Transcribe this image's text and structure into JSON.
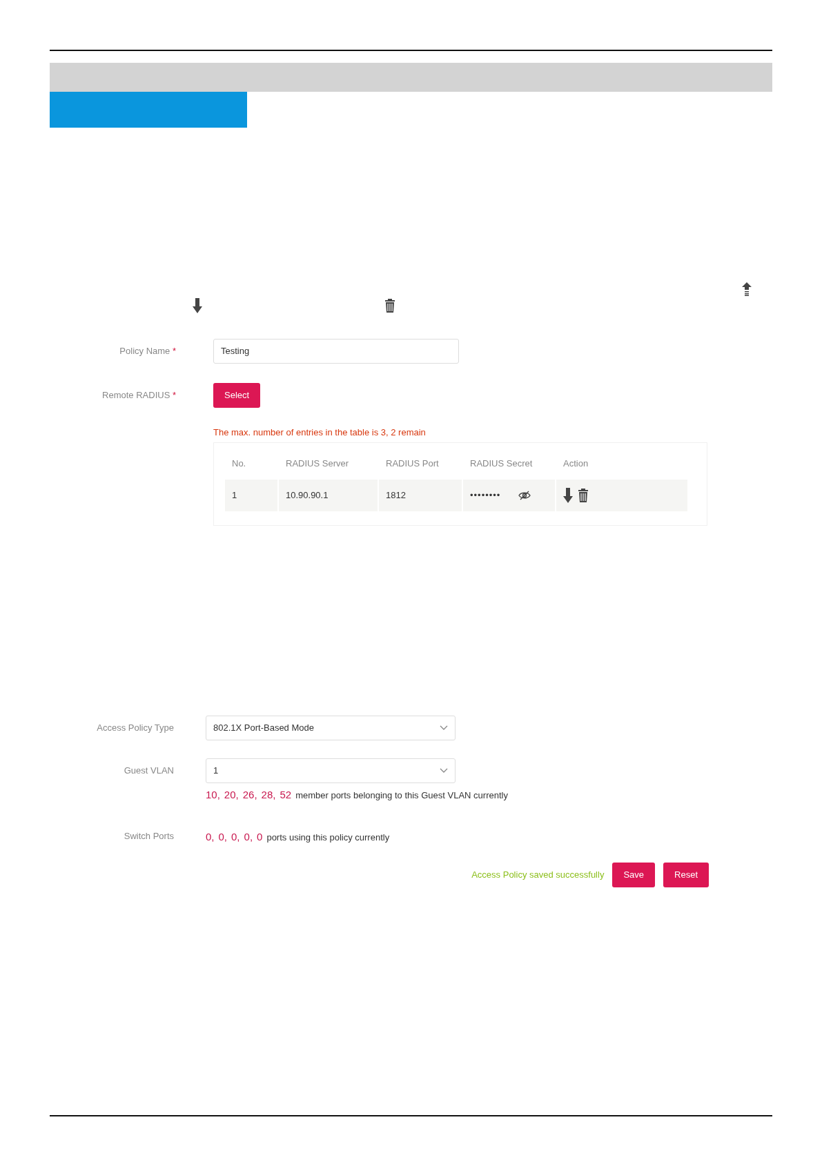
{
  "page_header": {
    "kind": "rule"
  },
  "section_bar": {
    "kind": "band"
  },
  "section_tab": {
    "kind": "tab"
  },
  "inline_icons": [
    {
      "kind": "upload"
    },
    {
      "kind": "download"
    },
    {
      "kind": "trash"
    }
  ],
  "policy_form": {
    "fields": [
      {
        "label": "Policy Name",
        "required_mark": "*",
        "kind": "input",
        "value": "Testing"
      },
      {
        "label": "Remote RADIUS",
        "required_mark": "*",
        "kind": "button",
        "value": "Select"
      }
    ],
    "notice": "The max. number of entries in the table is 3, 2 remain",
    "table": {
      "columns": [
        "No.",
        "RADIUS Server",
        "RADIUS Port",
        "RADIUS Secret",
        "Action"
      ],
      "rows": [
        {
          "no": "1",
          "server": "10.90.90.1",
          "port": "1812",
          "secret": "••••••••"
        }
      ]
    }
  },
  "access_form": {
    "fields": [
      {
        "label": "Access Policy Type",
        "kind": "select",
        "value": "802.1X Port-Based Mode"
      },
      {
        "label": "Guest VLAN",
        "kind": "select",
        "value": "1",
        "counts": [
          "10,",
          "20,",
          "26,",
          "28,",
          "52"
        ],
        "note": "member ports belonging to this Guest VLAN currently"
      },
      {
        "label": "Switch Ports",
        "kind": "counts",
        "counts": [
          "0,",
          "0,",
          "0,",
          "0,",
          "0"
        ],
        "note": "ports using this policy currently"
      }
    ],
    "status": "Access Policy saved successfully",
    "buttons": [
      "Save",
      "Reset"
    ]
  },
  "page_footer": {
    "kind": "rule"
  }
}
